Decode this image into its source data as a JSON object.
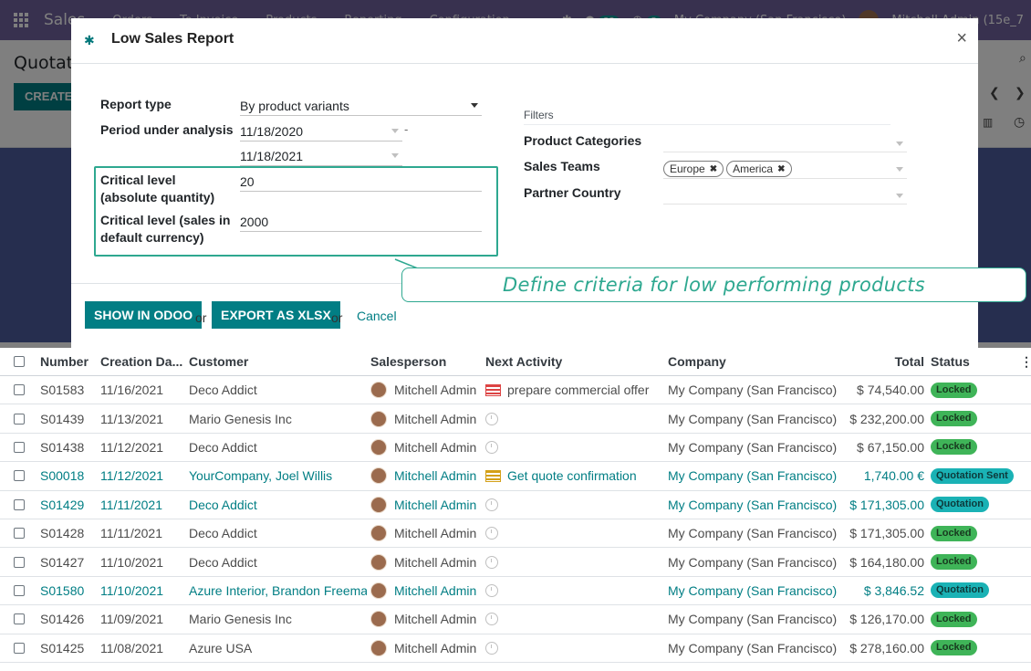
{
  "navbar": {
    "brand": "Sales",
    "menu": [
      "Orders",
      "To Invoice",
      "Products",
      "Reporting",
      "Configuration"
    ],
    "badge_messages": "22",
    "badge_activities": "5",
    "company": "My Company (San Francisco)",
    "user": "Mitchell Admin (15e_7"
  },
  "control_panel": {
    "breadcrumb": "Quotations",
    "create_label": "CREATE"
  },
  "modal": {
    "title": "Low Sales Report",
    "report_type_label": "Report type",
    "report_type_value": "By product variants",
    "period_label": "Period under analysis",
    "period_start": "11/18/2020",
    "period_end": "11/18/2021",
    "critical_qty_label": "Critical level (absolute quantity)",
    "critical_qty_value": "20",
    "critical_sales_label": "Critical level (sales in default currency)",
    "critical_sales_value": "2000",
    "filters_title": "Filters",
    "product_categories_label": "Product Categories",
    "sales_teams_label": "Sales Teams",
    "sales_teams_tags": [
      "Europe",
      "America"
    ],
    "partner_country_label": "Partner Country",
    "show_button": "SHOW IN ODOO",
    "or_1": "or",
    "export_button": "EXPORT AS XLSX",
    "or_2": "or",
    "cancel_label": "Cancel"
  },
  "callout": {
    "text": "Define criteria for low performing products"
  },
  "list": {
    "headers": [
      "Number",
      "Creation Da...",
      "Customer",
      "Salesperson",
      "Next Activity",
      "Company",
      "Total",
      "Status"
    ],
    "rows": [
      {
        "number": "S01583",
        "date": "11/16/2021",
        "customer": "Deco Addict",
        "salesperson": "Mitchell Admin",
        "activity": "prepare commercial offer",
        "activity_icon": "red-list-icon",
        "company": "My Company (San Francisco)",
        "total": "$ 74,540.00",
        "status": "Locked",
        "style": "muted"
      },
      {
        "number": "S01439",
        "date": "11/13/2021",
        "customer": "Mario Genesis Inc",
        "salesperson": "Mitchell Admin",
        "activity": "",
        "activity_icon": "clock-icon",
        "company": "My Company (San Francisco)",
        "total": "$ 232,200.00",
        "status": "Locked",
        "style": "muted"
      },
      {
        "number": "S01438",
        "date": "11/12/2021",
        "customer": "Deco Addict",
        "salesperson": "Mitchell Admin",
        "activity": "",
        "activity_icon": "clock-icon",
        "company": "My Company (San Francisco)",
        "total": "$ 67,150.00",
        "status": "Locked",
        "style": "muted"
      },
      {
        "number": "S00018",
        "date": "11/12/2021",
        "customer": "YourCompany, Joel Willis",
        "salesperson": "Mitchell Admin",
        "activity": "Get quote confirmation",
        "activity_icon": "yellow-list-icon",
        "company": "My Company (San Francisco)",
        "total": "1,740.00 €",
        "status": "Quotation Sent",
        "style": "link"
      },
      {
        "number": "S01429",
        "date": "11/11/2021",
        "customer": "Deco Addict",
        "salesperson": "Mitchell Admin",
        "activity": "",
        "activity_icon": "clock-icon",
        "company": "My Company (San Francisco)",
        "total": "$ 171,305.00",
        "status": "Quotation",
        "style": "link"
      },
      {
        "number": "S01428",
        "date": "11/11/2021",
        "customer": "Deco Addict",
        "salesperson": "Mitchell Admin",
        "activity": "",
        "activity_icon": "clock-icon",
        "company": "My Company (San Francisco)",
        "total": "$ 171,305.00",
        "status": "Locked",
        "style": "muted"
      },
      {
        "number": "S01427",
        "date": "11/10/2021",
        "customer": "Deco Addict",
        "salesperson": "Mitchell Admin",
        "activity": "",
        "activity_icon": "clock-icon",
        "company": "My Company (San Francisco)",
        "total": "$ 164,180.00",
        "status": "Locked",
        "style": "muted"
      },
      {
        "number": "S01580",
        "date": "11/10/2021",
        "customer": "Azure Interior, Brandon Freeman",
        "salesperson": "Mitchell Admin",
        "activity": "",
        "activity_icon": "clock-icon",
        "company": "My Company (San Francisco)",
        "total": "$ 3,846.52",
        "status": "Quotation",
        "style": "link"
      },
      {
        "number": "S01426",
        "date": "11/09/2021",
        "customer": "Mario Genesis Inc",
        "salesperson": "Mitchell Admin",
        "activity": "",
        "activity_icon": "clock-icon",
        "company": "My Company (San Francisco)",
        "total": "$ 126,170.00",
        "status": "Locked",
        "style": "muted"
      },
      {
        "number": "S01425",
        "date": "11/08/2021",
        "customer": "Azure USA",
        "salesperson": "Mitchell Admin",
        "activity": "",
        "activity_icon": "clock-icon",
        "company": "My Company (San Francisco)",
        "total": "$ 278,160.00",
        "status": "Locked",
        "style": "muted"
      }
    ]
  },
  "colors": {
    "navbar": "#71639e",
    "primary": "#017e84",
    "accent": "#2ea890",
    "locked_badge": "#3fb458",
    "quotation_badge": "#1ab2b5"
  }
}
